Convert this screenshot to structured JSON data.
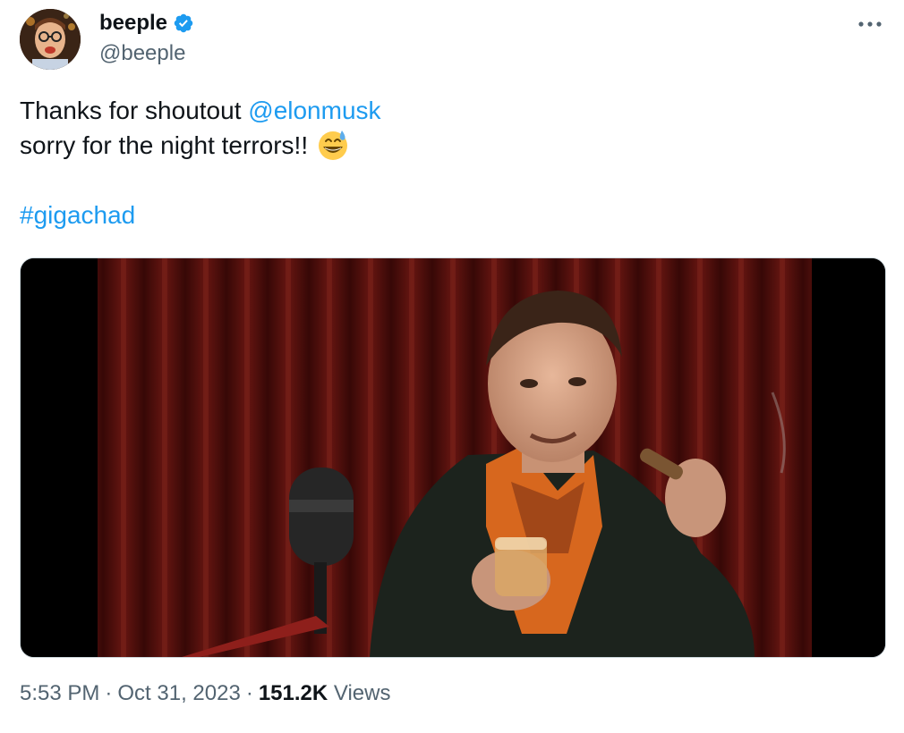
{
  "author": {
    "display_name": "beeple",
    "handle": "@beeple",
    "verified": true,
    "verified_color": "#1d9bf0"
  },
  "menu": {
    "more_icon": "ellipsis-icon"
  },
  "tweet": {
    "line1_text": "Thanks for shoutout ",
    "mention": "@elonmusk",
    "line2_text": "sorry for the night terrors!!",
    "emoji": "😅",
    "hashtag": "#gigachad",
    "link_color": "#1d9bf0"
  },
  "meta": {
    "time": "5:53 PM",
    "separator": "·",
    "date": "Oct 31, 2023",
    "views_count": "151.2K",
    "views_label": "Views"
  }
}
